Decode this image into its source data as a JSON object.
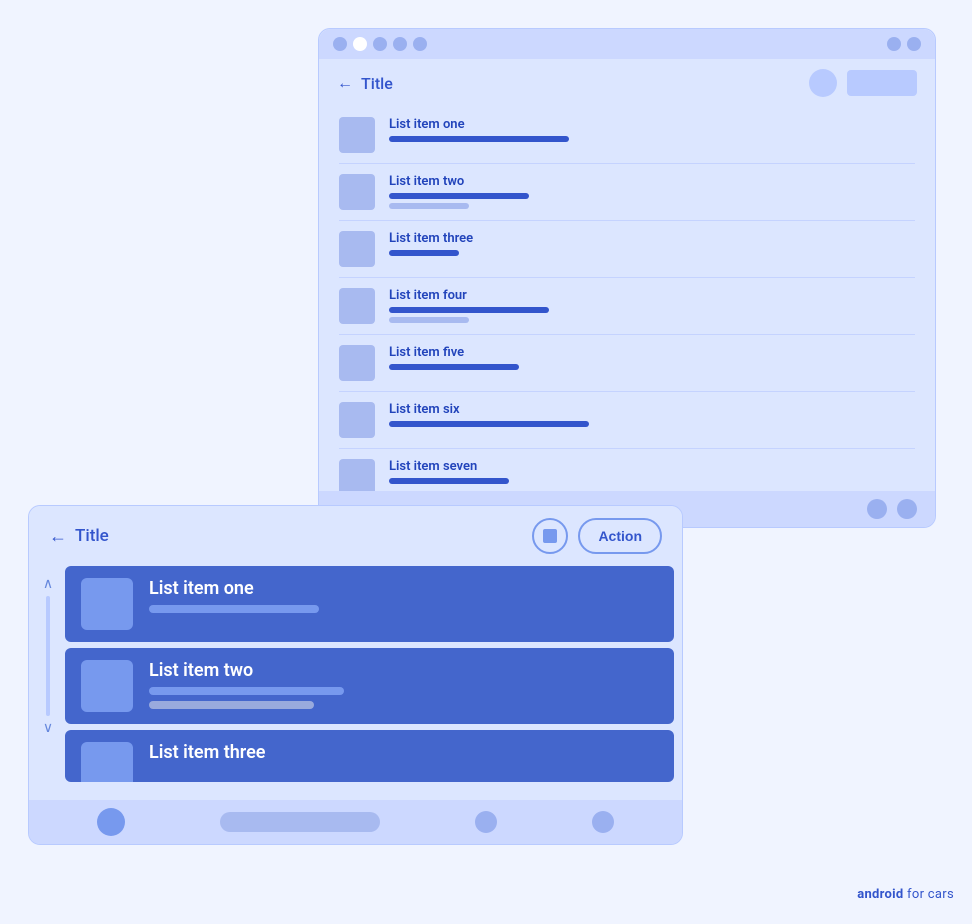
{
  "backCard": {
    "title": "Title",
    "chromeDots": [
      "dot",
      "white-dot",
      "dot",
      "dot",
      "dot"
    ],
    "rightButtons": [
      "icon-btn",
      "text-btn"
    ],
    "listItems": [
      {
        "id": 1,
        "label": "List item one",
        "bar1Width": 180,
        "bar2Width": 0
      },
      {
        "id": 2,
        "label": "List item two",
        "bar1Width": 140,
        "bar2Width": 80
      },
      {
        "id": 3,
        "label": "List item three",
        "bar1Width": 70,
        "bar2Width": 0
      },
      {
        "id": 4,
        "label": "List item four",
        "bar1Width": 160,
        "bar2Width": 80
      },
      {
        "id": 5,
        "label": "List item five",
        "bar1Width": 130,
        "bar2Width": 0
      },
      {
        "id": 6,
        "label": "List item six",
        "bar1Width": 200,
        "bar2Width": 0
      },
      {
        "id": 7,
        "label": "List item seven",
        "bar1Width": 120,
        "bar2Width": 0
      }
    ]
  },
  "frontCard": {
    "title": "Title",
    "actionLabel": "Action",
    "listItems": [
      {
        "id": 1,
        "label": "List item one",
        "bar1Width": 170,
        "bar2Width": 0
      },
      {
        "id": 2,
        "label": "List item two",
        "bar1Width": 195,
        "bar2Width": 165
      },
      {
        "id": 3,
        "label": "List item three",
        "bar1Width": 200,
        "bar2Width": 0
      }
    ]
  },
  "watermark": {
    "prefix": "android",
    "suffix": " for cars"
  }
}
